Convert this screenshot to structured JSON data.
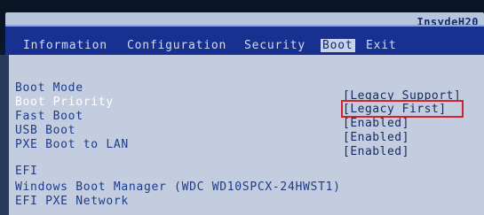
{
  "vendor": "InsydeH20",
  "tabs": [
    {
      "label": "Information"
    },
    {
      "label": "Configuration"
    },
    {
      "label": "Security"
    },
    {
      "label": "Boot"
    },
    {
      "label": "Exit"
    }
  ],
  "active_tab": "Boot",
  "settings": [
    {
      "label": "Boot Mode",
      "value": "[Legacy Support]"
    },
    {
      "label": "Boot Priority",
      "value": "[Legacy First]"
    },
    {
      "label": "Fast Boot",
      "value": "[Enabled]"
    },
    {
      "label": "USB Boot",
      "value": "[Enabled]"
    },
    {
      "label": "PXE Boot to LAN",
      "value": "[Enabled]"
    }
  ],
  "efi_section": {
    "heading": "EFI",
    "items": [
      "Windows Boot Manager (WDC WD10SPCX-24HWST1)",
      "EFI PXE Network"
    ]
  },
  "colors": {
    "menubar": "#18308f",
    "panel": "#c4cde0",
    "highlight_box": "#d4212b",
    "text": "#1c3c8a"
  }
}
